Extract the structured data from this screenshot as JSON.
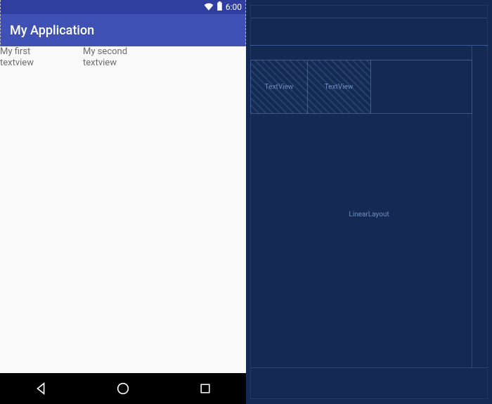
{
  "status_bar": {
    "time": "6:00"
  },
  "app_bar": {
    "title": "My Application"
  },
  "textviews": [
    {
      "text": "My first\ntextview"
    },
    {
      "text": "My second\ntextview"
    }
  ],
  "blueprint": {
    "cells": [
      {
        "label": "TextView"
      },
      {
        "label": "TextView"
      }
    ],
    "container_label": "LinearLayout"
  },
  "colors": {
    "primary": "#3F51B5",
    "primary_dark": "#303F9F",
    "blueprint_bg": "#152a52",
    "blueprint_line": "#3a5a95"
  }
}
